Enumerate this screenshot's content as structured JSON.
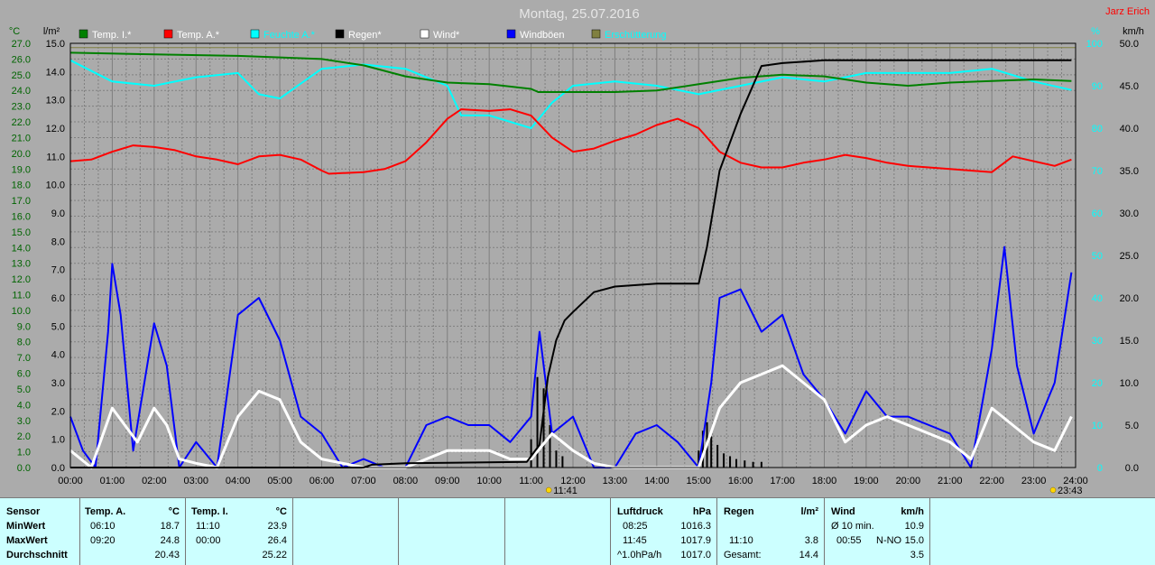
{
  "title": "Montag, 25.07.2016",
  "author": "Jarz Erich",
  "axes": {
    "left_outer_unit": "°C",
    "left_inner_unit": "l/m²",
    "right_inner_unit": "%",
    "right_outer_unit": "km/h",
    "left_outer_ticks": [
      "0.0",
      "1.0",
      "2.0",
      "3.0",
      "4.0",
      "5.0",
      "6.0",
      "7.0",
      "8.0",
      "9.0",
      "10.0",
      "11.0",
      "12.0",
      "13.0",
      "14.0",
      "15.0",
      "16.0",
      "17.0",
      "18.0",
      "19.0",
      "20.0",
      "21.0",
      "22.0",
      "23.0",
      "24.0",
      "25.0",
      "26.0",
      "27.0"
    ],
    "left_inner_ticks": [
      "0.0",
      "1.0",
      "2.0",
      "3.0",
      "4.0",
      "5.0",
      "6.0",
      "7.0",
      "8.0",
      "9.0",
      "10.0",
      "11.0",
      "12.0",
      "13.0",
      "14.0",
      "15.0"
    ],
    "right_inner_ticks": [
      "0",
      "10",
      "20",
      "30",
      "40",
      "50",
      "60",
      "70",
      "80",
      "90",
      "100"
    ],
    "right_outer_ticks": [
      "0.0",
      "5.0",
      "10.0",
      "15.0",
      "20.0",
      "25.0",
      "30.0",
      "35.0",
      "40.0",
      "45.0",
      "50.0"
    ],
    "x_ticks": [
      "00:00",
      "01:00",
      "02:00",
      "03:00",
      "04:00",
      "05:00",
      "06:00",
      "07:00",
      "08:00",
      "09:00",
      "10:00",
      "11:00",
      "12:00",
      "13:00",
      "14:00",
      "15:00",
      "16:00",
      "17:00",
      "18:00",
      "19:00",
      "20:00",
      "21:00",
      "22:00",
      "23:00",
      "24:00"
    ],
    "sun_markers": [
      {
        "label": "11:41",
        "hour": 11.68
      },
      {
        "label": "23:43",
        "hour": 23.72
      }
    ]
  },
  "colors": {
    "temp_i": "#008000",
    "temp_a": "#ff0000",
    "feuchte": "#00ffff",
    "regen": "#000000",
    "wind": "#ffffff",
    "windboeen": "#0000ff",
    "erschuetterung": "#808040",
    "grid": "#7f7f7f",
    "plot_bg": "#ababab"
  },
  "legend": [
    {
      "label": "Temp. I.*",
      "color": "#008000",
      "label_color": "#ffffff"
    },
    {
      "label": "Temp. A.*",
      "color": "#ff0000",
      "label_color": "#ffffff"
    },
    {
      "label": "Feuchte A.*",
      "color": "#00ffff",
      "label_color": "#00ffff"
    },
    {
      "label": "Regen*",
      "color": "#000000",
      "label_color": "#ffffff"
    },
    {
      "label": "Wind*",
      "color": "#ffffff",
      "label_color": "#ffffff"
    },
    {
      "label": "Windböen",
      "color": "#0000ff",
      "label_color": "#ffffff"
    },
    {
      "label": "Erschütterung",
      "color": "#808040",
      "label_color": "#00ffff"
    }
  ],
  "chart_data": {
    "type": "line",
    "title": "Montag, 25.07.2016",
    "x_unit": "hour",
    "xlim": [
      0,
      24
    ],
    "series": [
      {
        "name": "Temp. I.*",
        "axis": "temp_c",
        "points": [
          [
            0,
            26.4
          ],
          [
            2,
            26.3
          ],
          [
            4,
            26.2
          ],
          [
            6,
            26.0
          ],
          [
            7,
            25.6
          ],
          [
            8,
            24.9
          ],
          [
            9,
            24.5
          ],
          [
            10,
            24.4
          ],
          [
            11,
            24.1
          ],
          [
            11.17,
            23.9
          ],
          [
            12,
            23.9
          ],
          [
            13,
            23.9
          ],
          [
            14,
            24.0
          ],
          [
            15,
            24.4
          ],
          [
            16,
            24.8
          ],
          [
            17,
            25.0
          ],
          [
            18,
            24.9
          ],
          [
            19,
            24.5
          ],
          [
            20,
            24.3
          ],
          [
            21,
            24.5
          ],
          [
            22,
            24.6
          ],
          [
            23,
            24.7
          ],
          [
            23.9,
            24.6
          ]
        ]
      },
      {
        "name": "Temp. A.*",
        "axis": "temp_c",
        "points": [
          [
            0,
            19.5
          ],
          [
            0.5,
            19.6
          ],
          [
            1,
            20.1
          ],
          [
            1.5,
            20.5
          ],
          [
            2,
            20.4
          ],
          [
            2.5,
            20.2
          ],
          [
            3,
            19.8
          ],
          [
            3.5,
            19.6
          ],
          [
            4,
            19.3
          ],
          [
            4.5,
            19.8
          ],
          [
            5,
            19.9
          ],
          [
            5.5,
            19.6
          ],
          [
            6,
            18.9
          ],
          [
            6.17,
            18.7
          ],
          [
            7,
            18.8
          ],
          [
            7.5,
            19.0
          ],
          [
            8,
            19.5
          ],
          [
            8.5,
            20.7
          ],
          [
            9,
            22.2
          ],
          [
            9.33,
            22.8
          ],
          [
            10,
            22.7
          ],
          [
            10.5,
            22.8
          ],
          [
            11,
            22.4
          ],
          [
            11.5,
            21.0
          ],
          [
            12,
            20.1
          ],
          [
            12.5,
            20.3
          ],
          [
            13,
            20.8
          ],
          [
            13.5,
            21.2
          ],
          [
            14,
            21.8
          ],
          [
            14.5,
            22.2
          ],
          [
            15,
            21.6
          ],
          [
            15.5,
            20.1
          ],
          [
            16,
            19.4
          ],
          [
            16.5,
            19.1
          ],
          [
            17,
            19.1
          ],
          [
            17.5,
            19.4
          ],
          [
            18,
            19.6
          ],
          [
            18.5,
            19.9
          ],
          [
            19,
            19.7
          ],
          [
            19.5,
            19.4
          ],
          [
            20,
            19.2
          ],
          [
            21,
            19.0
          ],
          [
            22,
            18.8
          ],
          [
            22.5,
            19.8
          ],
          [
            23,
            19.5
          ],
          [
            23.5,
            19.2
          ],
          [
            23.9,
            19.6
          ]
        ]
      },
      {
        "name": "Feuchte A.*",
        "axis": "percent",
        "points": [
          [
            0,
            96
          ],
          [
            1,
            91
          ],
          [
            2,
            90
          ],
          [
            3,
            92
          ],
          [
            4,
            93
          ],
          [
            4.5,
            88
          ],
          [
            5,
            87
          ],
          [
            6,
            94
          ],
          [
            7,
            95
          ],
          [
            8,
            94
          ],
          [
            9,
            90
          ],
          [
            9.33,
            83
          ],
          [
            10,
            83
          ],
          [
            11,
            80
          ],
          [
            11.5,
            86
          ],
          [
            12,
            90
          ],
          [
            13,
            91
          ],
          [
            14,
            90
          ],
          [
            15,
            88
          ],
          [
            16,
            90
          ],
          [
            17,
            92
          ],
          [
            18,
            91
          ],
          [
            19,
            93
          ],
          [
            20,
            93
          ],
          [
            21,
            93
          ],
          [
            22,
            94
          ],
          [
            23,
            91
          ],
          [
            23.9,
            89
          ]
        ]
      },
      {
        "name": "Regen*",
        "axis": "rain_mm",
        "points": [
          [
            0,
            0
          ],
          [
            7,
            0
          ],
          [
            7.2,
            0.1
          ],
          [
            8,
            0.15
          ],
          [
            10.9,
            0.2
          ],
          [
            11.2,
            0.8
          ],
          [
            11.4,
            3.2
          ],
          [
            11.6,
            4.5
          ],
          [
            11.8,
            5.2
          ],
          [
            12,
            5.5
          ],
          [
            12.5,
            6.2
          ],
          [
            13,
            6.4
          ],
          [
            14,
            6.5
          ],
          [
            15,
            6.5
          ],
          [
            15.2,
            7.8
          ],
          [
            15.5,
            10.5
          ],
          [
            16,
            12.5
          ],
          [
            16.5,
            14.2
          ],
          [
            17,
            14.3
          ],
          [
            18,
            14.4
          ],
          [
            23.9,
            14.4
          ]
        ]
      },
      {
        "name": "Wind*",
        "axis": "wind_kmh",
        "points": [
          [
            0,
            2
          ],
          [
            0.5,
            0
          ],
          [
            1,
            7
          ],
          [
            1.3,
            5
          ],
          [
            1.6,
            3
          ],
          [
            2,
            7
          ],
          [
            2.3,
            5
          ],
          [
            2.6,
            1
          ],
          [
            3,
            0.5
          ],
          [
            3.5,
            0
          ],
          [
            4,
            6
          ],
          [
            4.5,
            9
          ],
          [
            5,
            8
          ],
          [
            5.5,
            3
          ],
          [
            6,
            1
          ],
          [
            6.5,
            0.5
          ],
          [
            7,
            0
          ],
          [
            8,
            0
          ],
          [
            9,
            2
          ],
          [
            10,
            2
          ],
          [
            10.5,
            1
          ],
          [
            11,
            1
          ],
          [
            11.5,
            4
          ],
          [
            12,
            2
          ],
          [
            12.5,
            0.5
          ],
          [
            13,
            0
          ],
          [
            14,
            0
          ],
          [
            15,
            0
          ],
          [
            15.5,
            7
          ],
          [
            16,
            10
          ],
          [
            16.5,
            11
          ],
          [
            17,
            12
          ],
          [
            17.5,
            10
          ],
          [
            18,
            8
          ],
          [
            18.5,
            3
          ],
          [
            19,
            5
          ],
          [
            19.5,
            6
          ],
          [
            20,
            5
          ],
          [
            20.5,
            4
          ],
          [
            21,
            3
          ],
          [
            21.5,
            1
          ],
          [
            22,
            7
          ],
          [
            22.5,
            5
          ],
          [
            23,
            3
          ],
          [
            23.5,
            2
          ],
          [
            23.9,
            6
          ]
        ]
      },
      {
        "name": "Windböen",
        "axis": "wind_kmh",
        "points": [
          [
            0,
            6
          ],
          [
            0.3,
            2
          ],
          [
            0.6,
            0
          ],
          [
            0.9,
            16
          ],
          [
            1,
            24
          ],
          [
            1.2,
            18
          ],
          [
            1.5,
            2
          ],
          [
            2,
            17
          ],
          [
            2.3,
            12
          ],
          [
            2.6,
            0
          ],
          [
            3,
            3
          ],
          [
            3.5,
            0
          ],
          [
            4,
            18
          ],
          [
            4.5,
            20
          ],
          [
            5,
            15
          ],
          [
            5.5,
            6
          ],
          [
            6,
            4
          ],
          [
            6.5,
            0
          ],
          [
            7,
            1
          ],
          [
            7.5,
            0
          ],
          [
            8,
            0
          ],
          [
            8.5,
            5
          ],
          [
            9,
            6
          ],
          [
            9.5,
            5
          ],
          [
            10,
            5
          ],
          [
            10.5,
            3
          ],
          [
            11,
            6
          ],
          [
            11.2,
            16
          ],
          [
            11.5,
            4
          ],
          [
            12,
            6
          ],
          [
            12.5,
            0
          ],
          [
            13,
            0
          ],
          [
            13.5,
            4
          ],
          [
            14,
            5
          ],
          [
            14.5,
            3
          ],
          [
            15,
            0
          ],
          [
            15.3,
            10
          ],
          [
            15.5,
            20
          ],
          [
            16,
            21
          ],
          [
            16.5,
            16
          ],
          [
            17,
            18
          ],
          [
            17.5,
            11
          ],
          [
            18,
            8
          ],
          [
            18.5,
            4
          ],
          [
            19,
            9
          ],
          [
            19.5,
            6
          ],
          [
            20,
            6
          ],
          [
            20.5,
            5
          ],
          [
            21,
            4
          ],
          [
            21.5,
            0
          ],
          [
            22,
            14
          ],
          [
            22.3,
            26
          ],
          [
            22.6,
            12
          ],
          [
            23,
            4
          ],
          [
            23.5,
            10
          ],
          [
            23.9,
            23
          ]
        ]
      },
      {
        "name": "Erschütterung",
        "axis": "percent",
        "points": [
          [
            0,
            99
          ],
          [
            24,
            99
          ]
        ]
      }
    ],
    "rain_bars": [
      [
        11.0,
        1.0
      ],
      [
        11.15,
        3.2
      ],
      [
        11.3,
        2.8
      ],
      [
        11.45,
        1.5
      ],
      [
        11.6,
        0.6
      ],
      [
        11.75,
        0.4
      ],
      [
        15.0,
        0.6
      ],
      [
        15.1,
        1.3
      ],
      [
        15.2,
        1.6
      ],
      [
        15.3,
        1.1
      ],
      [
        15.45,
        0.8
      ],
      [
        15.6,
        0.5
      ],
      [
        15.75,
        0.4
      ],
      [
        15.9,
        0.3
      ],
      [
        16.1,
        0.25
      ],
      [
        16.3,
        0.2
      ],
      [
        16.5,
        0.2
      ]
    ],
    "axis_ranges": {
      "temp_c": [
        0,
        27
      ],
      "rain_mm": [
        0,
        15
      ],
      "percent": [
        0,
        100
      ],
      "wind_kmh": [
        0,
        50
      ]
    },
    "grid": true
  },
  "panel": {
    "sensor": {
      "header": "Sensor",
      "rows": [
        "MinWert",
        "MaxWert",
        "Durchschnitt"
      ]
    },
    "temp_a": {
      "header": "Temp. A.",
      "unit": "°C",
      "rows": [
        [
          "06:10",
          "18.7"
        ],
        [
          "09:20",
          "24.8"
        ],
        [
          "",
          "20.43"
        ]
      ]
    },
    "temp_i": {
      "header": "Temp. I.",
      "unit": "°C",
      "rows": [
        [
          "11:10",
          "23.9"
        ],
        [
          "00:00",
          "26.4"
        ],
        [
          "",
          "25.22"
        ]
      ]
    },
    "luftdruck": {
      "header": "Luftdruck",
      "unit": "hPa",
      "rows": [
        [
          "08:25",
          "1016.3"
        ],
        [
          "11:45",
          "1017.9"
        ],
        [
          "^1.0hPa/h",
          "1017.0"
        ]
      ]
    },
    "regen": {
      "header": "Regen",
      "unit": "l/m²",
      "rows": [
        [
          "",
          ""
        ],
        [
          "11:10",
          "3.8"
        ],
        [
          "Gesamt:",
          "14.4"
        ]
      ]
    },
    "wind": {
      "header": "Wind",
      "unit": "km/h",
      "rows": [
        [
          "Ø 10 min.",
          "",
          "10.9"
        ],
        [
          "00:55",
          "N-NO",
          "15.0"
        ],
        [
          "",
          "",
          "3.5"
        ]
      ]
    }
  }
}
